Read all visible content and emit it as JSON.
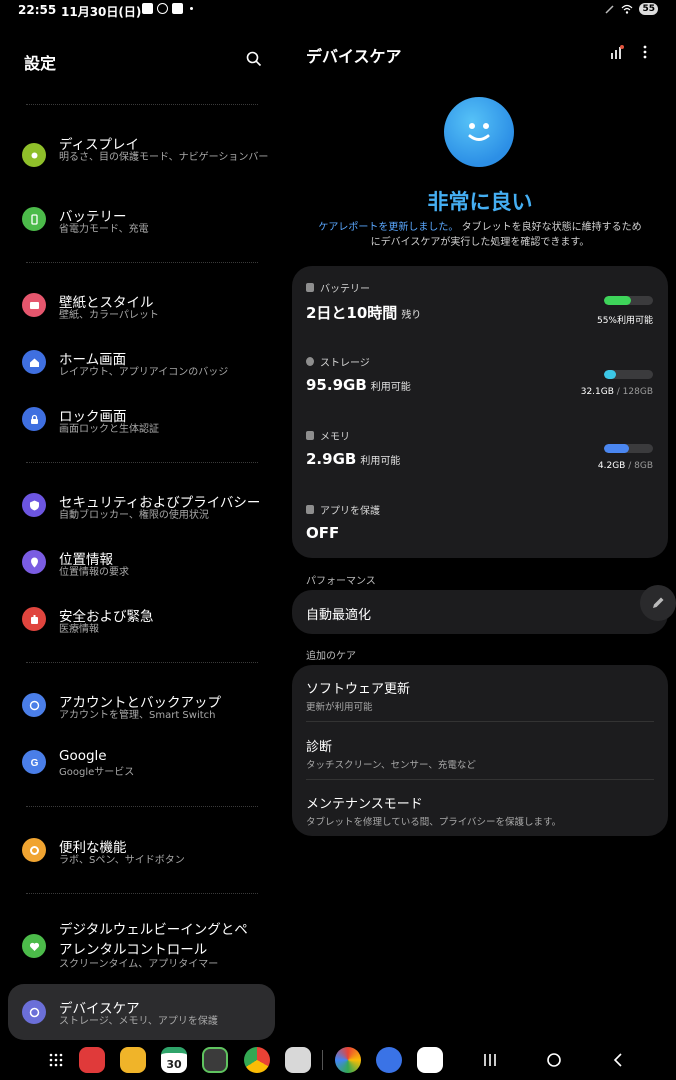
{
  "status_bar": {
    "time": "22:55",
    "date": "11月30日(日)",
    "battery": "55"
  },
  "left": {
    "title": "設定",
    "items": [
      {
        "title": "ディスプレイ",
        "subtitle": "明るさ、目の保護モード、ナビゲーションバー",
        "color": "#8fbf2a",
        "icon": "sun-icon"
      },
      {
        "title": "バッテリー",
        "subtitle": "省電力モード、充電",
        "color": "#4cbb4a",
        "icon": "battery-icon"
      },
      {
        "title": "壁紙とスタイル",
        "subtitle": "壁紙、カラーパレット",
        "color": "#e5566d",
        "icon": "image-icon"
      },
      {
        "title": "ホーム画面",
        "subtitle": "レイアウト、アプリアイコンのバッジ",
        "color": "#3f6fe0",
        "icon": "home-icon"
      },
      {
        "title": "ロック画面",
        "subtitle": "画面ロックと生体認証",
        "color": "#3f6fe0",
        "icon": "lock-icon"
      },
      {
        "title": "セキュリティおよびプライバシー",
        "subtitle": "自動ブロッカー、権限の使用状況",
        "color": "#6c55e0",
        "icon": "shield-icon"
      },
      {
        "title": "位置情報",
        "subtitle": "位置情報の要求",
        "color": "#7a5ce2",
        "icon": "location-icon"
      },
      {
        "title": "安全および緊急",
        "subtitle": "医療情報",
        "color": "#e0453e",
        "icon": "emergency-icon"
      },
      {
        "title": "アカウントとバックアップ",
        "subtitle": "アカウントを管理、Smart Switch",
        "color": "#4a7ee8",
        "icon": "sync-icon"
      },
      {
        "title": "Google",
        "subtitle": "Googleサービス",
        "color": "#4a7ee8",
        "icon": "google-icon"
      },
      {
        "title": "便利な機能",
        "subtitle": "ラボ、Sペン、サイドボタン",
        "color": "#f0a431",
        "icon": "gear-icon"
      },
      {
        "title": "デジタルウェルビーイングとペアレンタルコントロール",
        "subtitle": "スクリーンタイム、アプリタイマー",
        "color": "#4cbb4a",
        "icon": "heart-icon"
      },
      {
        "title": "デバイスケア",
        "subtitle": "ストレージ、メモリ、アプリを保護",
        "color": "#6b6fd8",
        "icon": "device-care-icon"
      }
    ]
  },
  "right": {
    "title": "デバイスケア",
    "status": "非常に良い",
    "report_link": "ケアレポートを更新しました。",
    "report_text_1": "タブレットを良好な状態に維持するため",
    "report_text_2": "にデバイスケアが実行した処理を確認できます。",
    "battery": {
      "label": "バッテリー",
      "value": "2日と10時間",
      "suffix": "残り",
      "caption": "55%利用可能",
      "level": 0.55,
      "color": "#3ed45a"
    },
    "storage": {
      "label": "ストレージ",
      "value": "95.9GB",
      "suffix": "利用可能",
      "used": "32.1GB",
      "sep": " / ",
      "total": "128GB",
      "level": 0.25,
      "color": "#3cc7e6"
    },
    "memory": {
      "label": "メモリ",
      "value": "2.9GB",
      "suffix": "利用可能",
      "used": "4.2GB",
      "sep": " / ",
      "total": "8GB",
      "level": 0.52,
      "color": "#4a86f0"
    },
    "protect": {
      "label": "アプリを保護",
      "value": "OFF"
    },
    "performance_label": "パフォーマンス",
    "auto_optimize": "自動最適化",
    "extra_label": "追加のケア",
    "extra": [
      {
        "title": "ソフトウェア更新",
        "subtitle": "更新が利用可能"
      },
      {
        "title": "診断",
        "subtitle": "タッチスクリーン、センサー、充電など"
      },
      {
        "title": "メンテナンスモード",
        "subtitle": "タブレットを修理している間、プライバシーを保護します。"
      }
    ]
  },
  "dock": {
    "calendar_day": "30"
  }
}
